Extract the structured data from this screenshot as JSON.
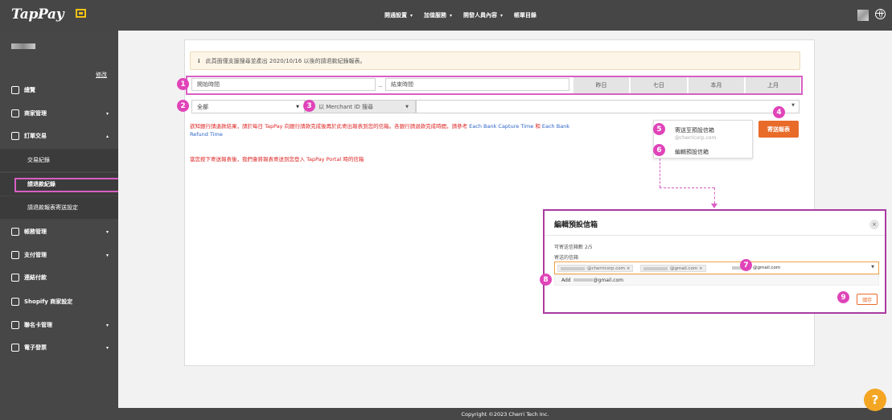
{
  "topbar": {
    "logo": "TapPay",
    "nav": [
      {
        "label": "開通設置",
        "caret": "▾"
      },
      {
        "label": "加值服務",
        "caret": "▾"
      },
      {
        "label": "開發人員內容",
        "caret": "▾"
      },
      {
        "label": "帳單目錄",
        "caret": ""
      }
    ],
    "icons": [
      "avatar",
      "globe-icon"
    ]
  },
  "sidebar": {
    "edit_label": "修改",
    "items": [
      {
        "label": "總覽",
        "icon": "grid-icon"
      },
      {
        "label": "商家管理",
        "icon": "store-icon",
        "arrow": "▾"
      },
      {
        "label": "訂單交易",
        "icon": "exchange-icon",
        "arrow": "▴"
      },
      {
        "label": "帳務管理",
        "icon": "bank-icon",
        "arrow": "▾"
      },
      {
        "label": "支付管理",
        "icon": "coin-icon",
        "arrow": "▾"
      },
      {
        "label": "連結付款",
        "icon": "link-icon"
      },
      {
        "label": "Shopify 商家設定",
        "icon": "shopify-icon"
      },
      {
        "label": "聯名卡管理",
        "icon": "card-icon",
        "arrow": "▾"
      },
      {
        "label": "電子發票",
        "icon": "invoice-icon",
        "arrow": "▾"
      }
    ],
    "subitems": [
      {
        "label": "交易紀錄"
      },
      {
        "label": "請退款紀錄"
      },
      {
        "label": "請退款報表寄送設定"
      }
    ]
  },
  "main": {
    "notice": "此頁面僅支援搜尋並產出 2020/10/16 以後的請退款紀錄報表。",
    "notice_icon": "ℹ",
    "date": {
      "start_label": "開始時間",
      "separator": "~",
      "end_label": "結束時間",
      "quick": [
        "昨日",
        "七日",
        "本月",
        "上月"
      ]
    },
    "filter": {
      "status_value": "全部",
      "search_mode": "以 Merchant ID 搜尋"
    },
    "info_text_1": "欲知銀行請退款結果，請於每日 TapPay 向銀行請款完成後再於此寄出報表到您的信箱。各銀行請退款完成時間，請參考",
    "info_link_1": "Each Bank Capture Time",
    "info_and": "和",
    "info_link_2": "Each Bank Refund Time",
    "info_text_2": "當您按下寄送報表後，我們會將報表寄送到您登入 TapPay Portal 時的信箱",
    "send_button": "寄送報表",
    "dropdown": {
      "item1": "寄送至預設信箱",
      "item1_email": "@cherricorp.com",
      "item2": "編輯預設信箱"
    }
  },
  "modal": {
    "title": "編輯預設信箱",
    "close": "×",
    "count_label": "可寄送信箱數 2/5",
    "field_label": "寄送的信箱",
    "tags": [
      "@cherricorp.com",
      "@gmail.com"
    ],
    "tag_remove": "×",
    "typed": "@gmail.com",
    "suggestion_prefix": "Add",
    "suggestion_suffix": "@gmail.com",
    "save_button": "儲存"
  },
  "callouts": [
    "1",
    "2",
    "3",
    "4",
    "5",
    "6",
    "7",
    "8",
    "9"
  ],
  "footer": "Copyright ©2023 Cherri Tech Inc.",
  "help": "?",
  "colors": {
    "topbar": "#464646",
    "accent_orange": "#e86b2a",
    "callout": "#e044b9",
    "link": "#2a63c7",
    "warning_text": "#d22"
  }
}
